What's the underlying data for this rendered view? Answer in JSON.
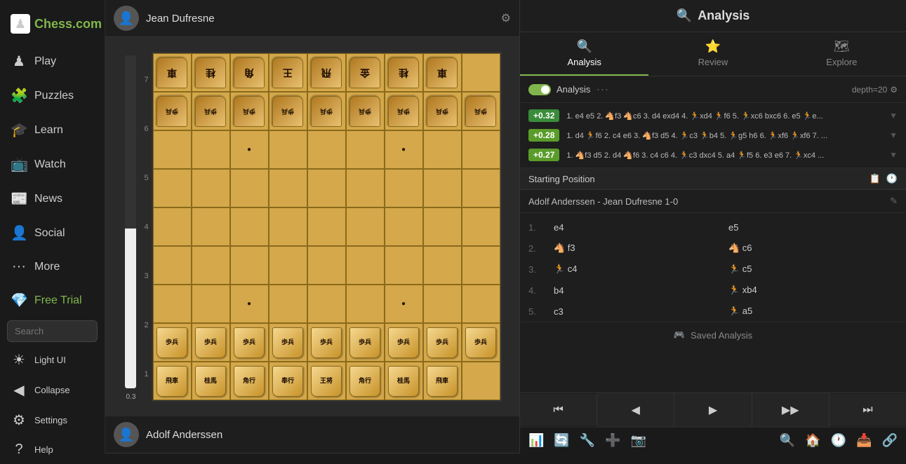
{
  "app": {
    "logo_text": "Chess.com",
    "logo_icon": "♟"
  },
  "sidebar": {
    "items": [
      {
        "id": "play",
        "label": "Play",
        "icon": "▶"
      },
      {
        "id": "puzzles",
        "label": "Puzzles",
        "icon": "🧩"
      },
      {
        "id": "learn",
        "label": "Learn",
        "icon": "🎓"
      },
      {
        "id": "watch",
        "label": "Watch",
        "icon": "📺"
      },
      {
        "id": "news",
        "label": "News",
        "icon": "📰"
      },
      {
        "id": "social",
        "label": "Social",
        "icon": "👤"
      },
      {
        "id": "more",
        "label": "More",
        "icon": "···"
      },
      {
        "id": "free-trial",
        "label": "Free Trial",
        "icon": "💎"
      }
    ],
    "search_placeholder": "Search"
  },
  "sidebar_bottom": [
    {
      "id": "light-ui",
      "label": "Light UI",
      "icon": "☀"
    },
    {
      "id": "collapse",
      "label": "Collapse",
      "icon": "◀"
    },
    {
      "id": "settings",
      "label": "Settings",
      "icon": "⚙"
    },
    {
      "id": "help",
      "label": "Help",
      "icon": "?"
    }
  ],
  "players": {
    "top": {
      "name": "Jean Dufresne"
    },
    "bottom": {
      "name": "Adolf Anderssen"
    }
  },
  "eval": {
    "value": "0.3"
  },
  "analysis": {
    "title": "Analysis",
    "tabs": [
      {
        "id": "analysis",
        "label": "Analysis",
        "icon": "🔍",
        "active": true
      },
      {
        "id": "review",
        "label": "Review",
        "icon": "⭐"
      },
      {
        "id": "explore",
        "label": "Explore",
        "icon": "🗺"
      }
    ],
    "toolbar": {
      "toggle_label": "Analysis",
      "depth_label": "depth=20"
    },
    "suggestions": [
      {
        "eval": "+0.32",
        "eval_class": "eval-green",
        "moves": "1. e4 e5 2. 🐴f3 🐴c6 3. d4 exd4 4. 🏃xd4 🏃f6 5. 🏃xc6 bxc6 6. e5 🏃e...",
        "arrow": "▼"
      },
      {
        "eval": "+0.28",
        "eval_class": "eval-yellow-green",
        "moves": "1. d4 🏃f6 2. c4 e6 3. 🐴f3 d5 4. 🏃c3 🏃b4 5. 🏃g5 h6 6. 🏃xf6 🏃xf6 7. ...",
        "arrow": "▼"
      },
      {
        "eval": "+0.27",
        "eval_class": "eval-yellow-green",
        "moves": "1. 🐴f3 d5 2. d4 🐴f6 3. c4 c6 4. 🏃c3 dxc4 5. a4 🏃f5 6. e3 e6 7. 🏃xc4 ...",
        "arrow": "▼"
      }
    ],
    "starting_position": "Starting Position",
    "game_info": "Adolf Anderssen  -  Jean Dufresne  1-0",
    "moves": [
      {
        "num": "1.",
        "white": "e4",
        "black": "e5",
        "white_icon": "",
        "black_icon": ""
      },
      {
        "num": "2.",
        "white": "🐴 f3",
        "black": "🐴 c6",
        "white_icon": "",
        "black_icon": ""
      },
      {
        "num": "3.",
        "white": "🏃 c4",
        "black": "🏃 c5",
        "white_icon": "",
        "black_icon": ""
      },
      {
        "num": "4.",
        "white": "b4",
        "black": "🏃 xb4",
        "white_icon": "",
        "black_icon": ""
      },
      {
        "num": "5.",
        "white": "c3",
        "black": "🏃 a5",
        "white_icon": "",
        "black_icon": ""
      }
    ],
    "saved_analysis_label": "Saved Analysis",
    "nav_buttons": [
      "⏮",
      "◀",
      "▶",
      "▶▶",
      "⏭"
    ],
    "nav_ids": [
      "first",
      "prev",
      "play",
      "next",
      "last"
    ]
  }
}
